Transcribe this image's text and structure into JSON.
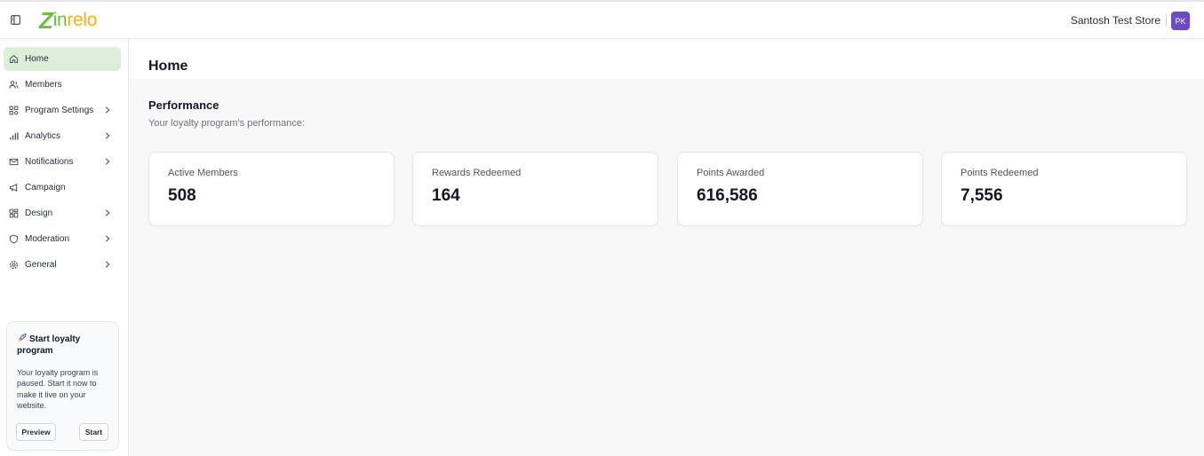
{
  "brand": {
    "logo_z": "Z",
    "logo_part1": "in",
    "logo_part2": "relo",
    "green": "#6abf40",
    "yellow": "#f2b21b"
  },
  "header": {
    "store_name": "Santosh Test Store",
    "avatar_initials": "PK",
    "avatar_color": "#6d4bc0",
    "collapse_icon": "sidebar-toggle-icon"
  },
  "sidebar": {
    "items": [
      {
        "label": "Home",
        "icon": "home-icon",
        "active": true,
        "has_chevron": false
      },
      {
        "label": "Members",
        "icon": "users-icon",
        "active": false,
        "has_chevron": false
      },
      {
        "label": "Program Settings",
        "icon": "grid-settings-icon",
        "active": false,
        "has_chevron": true
      },
      {
        "label": "Analytics",
        "icon": "bar-chart-icon",
        "active": false,
        "has_chevron": true
      },
      {
        "label": "Notifications",
        "icon": "mail-icon",
        "active": false,
        "has_chevron": true
      },
      {
        "label": "Campaign",
        "icon": "megaphone-icon",
        "active": false,
        "has_chevron": false
      },
      {
        "label": "Design",
        "icon": "layout-icon",
        "active": false,
        "has_chevron": true
      },
      {
        "label": "Moderation",
        "icon": "shield-icon",
        "active": false,
        "has_chevron": true
      },
      {
        "label": "General",
        "icon": "gear-icon",
        "active": false,
        "has_chevron": true
      }
    ],
    "active_color": "#dcefd9"
  },
  "promo": {
    "title": "Start loyalty program",
    "text": "Your loyalty program is paused. Start it now to make it live on your website.",
    "preview_label": "Preview",
    "start_label": "Start"
  },
  "main": {
    "page_title": "Home",
    "section_title": "Performance",
    "section_subtitle": "Your loyalty program's performance:",
    "cards": [
      {
        "label": "Active Members",
        "value": "508"
      },
      {
        "label": "Rewards Redeemed",
        "value": "164"
      },
      {
        "label": "Points Awarded",
        "value": "616,586"
      },
      {
        "label": "Points Redeemed",
        "value": "7,556"
      }
    ]
  }
}
